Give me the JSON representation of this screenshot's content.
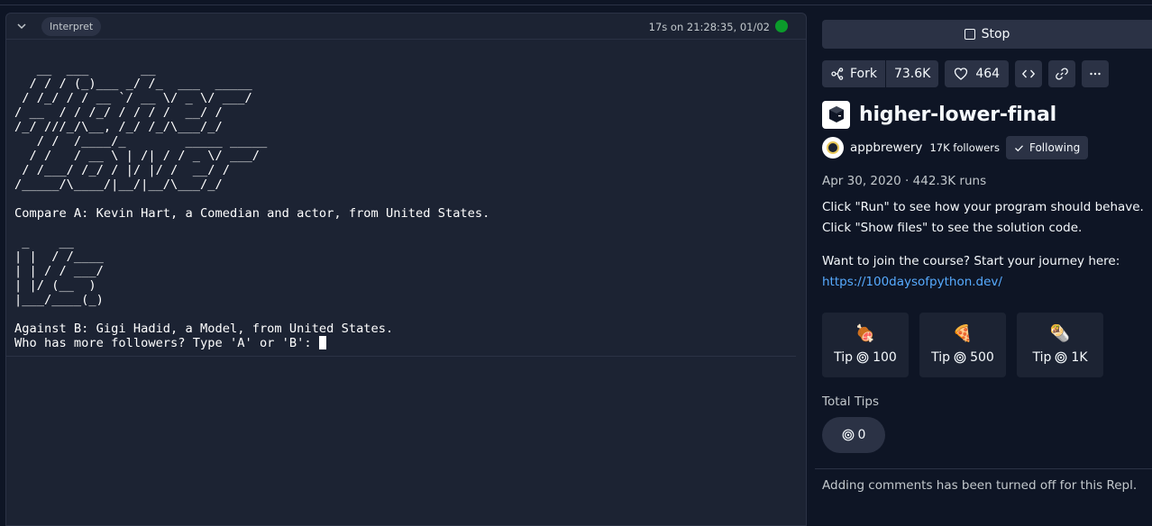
{
  "console": {
    "mode_label": "Interpret",
    "run_status": "17s on 21:28:35, 01/02",
    "status_color": "#0b9b2b",
    "output_lines": [
      "",
      "   __  ___       __",
      "  / / / (_)___ _/ /_  ___  _____",
      " / /_/ / / __ `/ __ \\/ _ \\/ ___/",
      "/ __  / / /_/ / / / /  __/ /",
      "/_/ ///_/\\__, /_/ /_/\\___/_/",
      "   / /  /____/_        _____ _____",
      "  / /   / __ \\ | /| / / _ \\/ ___/",
      " / /___/ /_/ / |/ |/ /  __/ /",
      "/_____/\\____/|__/|__/\\___/_/",
      "",
      "Compare A: Kevin Hart, a Comedian and actor, from United States.",
      "",
      " _    __",
      "| |  / /____",
      "| | / / ___/",
      "| |/ (__  )",
      "|___/____(_)",
      "",
      "Against B: Gigi Hadid, a Model, from United States."
    ],
    "prompt_line": "Who has more followers? Type 'A' or 'B': "
  },
  "sidebar": {
    "stop_label": "Stop",
    "fork_label": "Fork",
    "fork_count": "73.6K",
    "like_count": "464",
    "repl_title": "higher-lower-final",
    "owner": {
      "name": "appbrewery",
      "followers": "17K followers",
      "follow_label": "Following"
    },
    "meta": "Apr 30, 2020 · 442.3K runs",
    "description": {
      "line1": "Click \"Run\" to see how your program should behave.",
      "line2": "Click \"Show files\" to see the solution code.",
      "line3": "Want to join the course? Start your journey here:",
      "link": "https://100daysofpython.dev/"
    },
    "tips": [
      {
        "emoji": "🍖",
        "label": "Tip",
        "amount": "100"
      },
      {
        "emoji": "🍕",
        "label": "Tip",
        "amount": "500"
      },
      {
        "emoji": "🌯",
        "label": "Tip",
        "amount": "1K"
      }
    ],
    "total_tips_label": "Total Tips",
    "total_tips_value": "0",
    "comments_notice": "Adding comments has been turned off for this Repl."
  },
  "colors": {
    "background": "#0e1525",
    "panel": "#1c2333",
    "surface": "#2b3245",
    "link": "#57abff",
    "running_indicator": "#0b9b2b"
  }
}
